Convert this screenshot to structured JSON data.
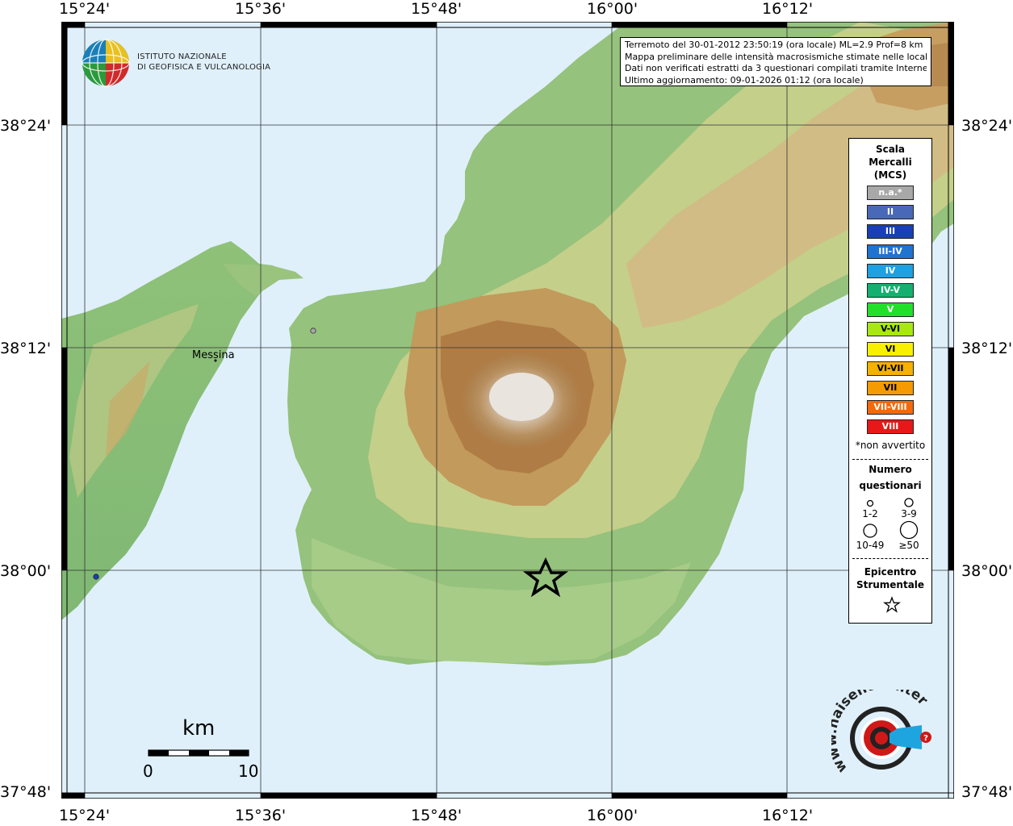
{
  "map": {
    "lon_ticks": [
      "15°24'",
      "15°36'",
      "15°48'",
      "16°00'",
      "16°12'"
    ],
    "lat_ticks": [
      "38°24'",
      "38°12'",
      "38°00'",
      "37°48'"
    ],
    "colors": {
      "sea": "#dff0fb",
      "frame": "#000000",
      "grid": "#333333"
    },
    "city": "Messina",
    "epicenter_marker": "star-icon"
  },
  "info": {
    "line1": "Terremoto del 30-01-2012 23:50:19 (ora locale) ML=2.9 Prof=8 km",
    "line2": "Mappa preliminare delle intensità macrosismiche stimate nelle località",
    "line3": "Dati non verificati estratti da 3 questionari compilati tramite Internet.",
    "line4": "Ultimo aggiornamento: 09-01-2026 01:12 (ora locale)"
  },
  "ingv": {
    "line1": "ISTITUTO NAZIONALE",
    "line2": "DI GEOFISICA E VULCANOLOGIA"
  },
  "legend": {
    "title1": "Scala",
    "title2": "Mercalli",
    "title3": "(MCS)",
    "levels": [
      {
        "label": "n.a.*",
        "color": "#a8a8a8"
      },
      {
        "label": "II",
        "color": "#4a68b8"
      },
      {
        "label": "III",
        "color": "#1a3fb5"
      },
      {
        "label": "III-IV",
        "color": "#1f73d1"
      },
      {
        "label": "IV",
        "color": "#1fa0e0"
      },
      {
        "label": "IV-V",
        "color": "#15b070"
      },
      {
        "label": "V",
        "color": "#22e02a"
      },
      {
        "label": "V-VI",
        "color": "#a8e810"
      },
      {
        "label": "VI",
        "color": "#f8f000"
      },
      {
        "label": "VI-VII",
        "color": "#f5b000"
      },
      {
        "label": "VII",
        "color": "#f59a00"
      },
      {
        "label": "VII-VIII",
        "color": "#f06a10"
      },
      {
        "label": "VIII",
        "color": "#e81818"
      }
    ],
    "note": "*non avvertito",
    "count_title1": "Numero",
    "count_title2": "questionari",
    "counts": [
      "1-2",
      "3-9",
      "10-49",
      "≥50"
    ],
    "epi_title1": "Epicentro",
    "epi_title2": "Strumentale"
  },
  "scalebar": {
    "unit": "km",
    "min": "0",
    "max": "10"
  },
  "hsit": {
    "url": "www.haisentitoilterremoto.it"
  }
}
